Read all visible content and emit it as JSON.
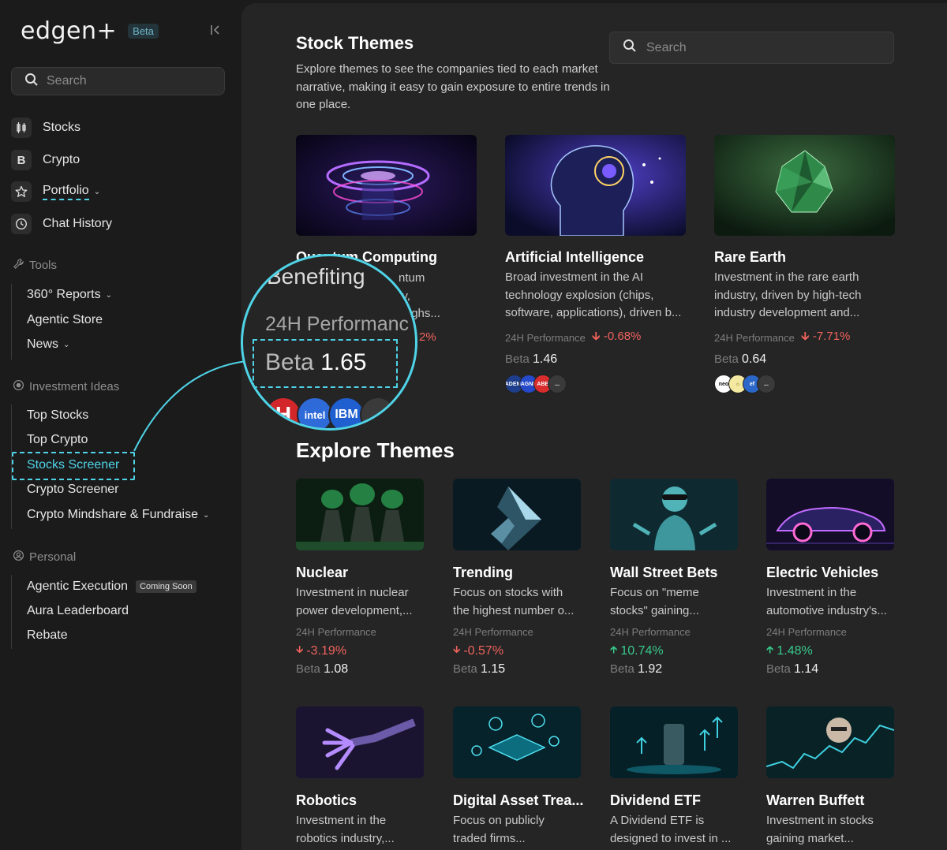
{
  "brand": {
    "name": "edgen+",
    "badge": "Beta"
  },
  "sidebar": {
    "search_placeholder": "Search",
    "primary": [
      {
        "label": "Stocks",
        "icon": "candlestick-icon"
      },
      {
        "label": "Crypto",
        "icon": "bitcoin-icon"
      },
      {
        "label": "Portfolio",
        "icon": "star-icon"
      },
      {
        "label": "Chat History",
        "icon": "clock-icon"
      }
    ],
    "tools_heading": "Tools",
    "tools": [
      "360° Reports",
      "Agentic Store",
      "News"
    ],
    "ideas_heading": "Investment Ideas",
    "ideas": [
      "Top Stocks",
      "Top Crypto",
      "Stocks Screener",
      "Crypto Screener",
      "Crypto Mindshare & Fundraise"
    ],
    "personal_heading": "Personal",
    "personal": [
      "Agentic Execution",
      "Aura Leaderboard",
      "Rebate"
    ],
    "coming_soon": "Coming Soon"
  },
  "main": {
    "title": "Stock Themes",
    "description": "Explore themes to see the companies tied to each market narrative, making it easy to gain exposure to entire trends in one place.",
    "search_placeholder": "Search",
    "perf_label": "24H Performance",
    "beta_label": "Beta",
    "themes": [
      {
        "title": "Quantum Computing",
        "desc": "",
        "perf": "",
        "beta": ""
      },
      {
        "title": "Artificial Intelligence",
        "desc": "Broad investment in the AI technology explosion (chips, software, applications), driven b...",
        "perf": "-0.68%",
        "beta": "1.46"
      },
      {
        "title": "Rare Earth",
        "desc": "Investment in the rare earth industry, driven by high-tech industry development and...",
        "perf": "-7.71%",
        "beta": "0.64"
      }
    ],
    "quantum_fragments": {
      "line1": "ntum",
      "line2": "gy,",
      "line3": "throughs...",
      "perf": "2%"
    },
    "explore_title": "Explore Themes",
    "explore": [
      {
        "title": "Nuclear",
        "desc": "Investment in nuclear power development,...",
        "perf": "-3.19%",
        "beta": "1.08",
        "dir": "down"
      },
      {
        "title": "Trending",
        "desc": "Focus on stocks with the highest number o...",
        "perf": "-0.57%",
        "beta": "1.15",
        "dir": "down"
      },
      {
        "title": "Wall Street Bets",
        "desc": "Focus on \"meme stocks\" gaining...",
        "perf": "10.74%",
        "beta": "1.92",
        "dir": "up"
      },
      {
        "title": "Electric Vehicles",
        "desc": "Investment in the automotive industry's...",
        "perf": "1.48%",
        "beta": "1.14",
        "dir": "up"
      },
      {
        "title": "Robotics",
        "desc": "Investment in the robotics industry,..."
      },
      {
        "title": "Digital Asset Trea...",
        "desc": "Focus on publicly traded firms..."
      },
      {
        "title": "Dividend ETF",
        "desc": "A Dividend ETF is designed to invest in ..."
      },
      {
        "title": "Warren Buffett",
        "desc": "Investment in stocks gaining market..."
      }
    ]
  },
  "magnifier": {
    "word": "Benefiting",
    "perf_label": "24H Performanc",
    "beta_label": "Beta",
    "beta_value": "1.65",
    "logos": [
      "H",
      "intel",
      "IBM",
      "..."
    ]
  },
  "logos": {
    "ai": [
      "CADENCE",
      "MAGNIFY",
      "ABB",
      "..."
    ],
    "rare": [
      "neo",
      "☼",
      "ef",
      "..."
    ]
  },
  "colors": {
    "accent": "#4fd3e6",
    "negative": "#f0635c",
    "positive": "#38c98a"
  }
}
